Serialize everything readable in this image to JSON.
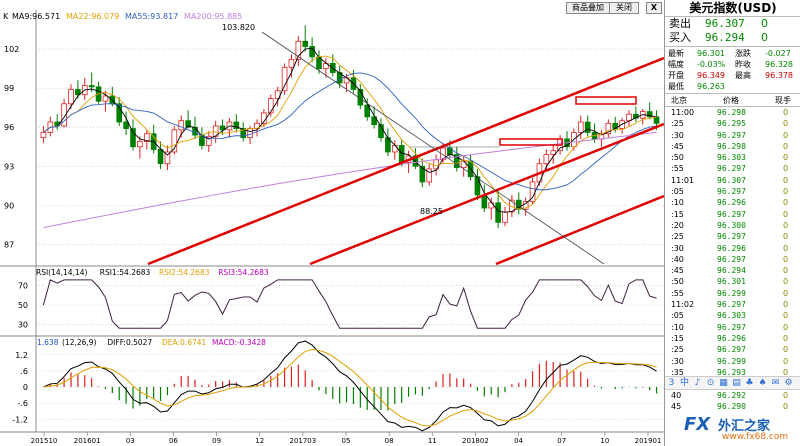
{
  "toolbar": {
    "k_label": "K",
    "ma_labels": [
      {
        "text": "MA9:96.571",
        "color": "#000000"
      },
      {
        "text": "MA22:96.079",
        "color": "#e0a000"
      },
      {
        "text": "MA55:93.817",
        "color": "#3060c0"
      },
      {
        "text": "MA200:95.885",
        "color": "#c080e0"
      }
    ],
    "add_button": "商品叠加",
    "close_button": "关闭",
    "x_button": "X"
  },
  "price_axis": [
    "102",
    "99",
    "96",
    "93",
    "90",
    "87"
  ],
  "annotations": {
    "high": "103.820",
    "low": "88.25"
  },
  "rsi": {
    "header": [
      {
        "text": "RSI(14,14,14)",
        "color": "#000000"
      },
      {
        "text": "RSI1:54.2683",
        "color": "#000000"
      },
      {
        "text": "RSI2:54.2683",
        "color": "#e0a000"
      },
      {
        "text": "RSI3:54.2683",
        "color": "#c000c0"
      }
    ],
    "axis": [
      "70",
      "50",
      "30"
    ]
  },
  "macd": {
    "left_value": "1.638",
    "header": [
      {
        "text": "(12,26,9)",
        "color": "#000000"
      },
      {
        "text": "DIFF:0.5027",
        "color": "#000000"
      },
      {
        "text": "DEA:0.6741",
        "color": "#e0a000"
      },
      {
        "text": "MACD:-0.3428",
        "color": "#c000c0"
      }
    ],
    "axis": [
      "1.2",
      ".6",
      "0",
      "-.6",
      "-1.2"
    ]
  },
  "date_axis": [
    "201510",
    "201601",
    "03",
    "06",
    "09",
    "12",
    "201703",
    "05",
    "08",
    "11",
    "201802",
    "04",
    "07",
    "10",
    "201901"
  ],
  "chart_data": {
    "type": "candlestick",
    "ylim": [
      85.5,
      105.0
    ],
    "ohlc": [
      [
        95.2,
        96.1,
        94.8,
        95.6
      ],
      [
        95.6,
        96.8,
        95.3,
        96.4
      ],
      [
        96.4,
        97.0,
        95.8,
        96.1
      ],
      [
        96.1,
        98.2,
        96.0,
        97.8
      ],
      [
        97.8,
        99.3,
        97.4,
        98.9
      ],
      [
        98.9,
        99.6,
        98.2,
        98.5
      ],
      [
        98.5,
        99.8,
        98.1,
        99.2
      ],
      [
        99.2,
        100.2,
        98.7,
        99.1
      ],
      [
        99.1,
        99.5,
        97.8,
        98.0
      ],
      [
        98.0,
        98.8,
        97.2,
        98.4
      ],
      [
        98.4,
        99.1,
        97.6,
        97.8
      ],
      [
        97.8,
        98.3,
        96.1,
        96.4
      ],
      [
        96.4,
        97.2,
        95.4,
        95.9
      ],
      [
        95.9,
        96.6,
        94.2,
        94.5
      ],
      [
        94.5,
        95.3,
        93.6,
        94.9
      ],
      [
        94.9,
        95.8,
        94.3,
        95.5
      ],
      [
        95.5,
        96.2,
        94.0,
        94.3
      ],
      [
        94.3,
        94.9,
        92.8,
        93.2
      ],
      [
        93.2,
        94.6,
        92.7,
        94.1
      ],
      [
        94.1,
        96.1,
        93.9,
        95.8
      ],
      [
        95.8,
        96.9,
        95.2,
        96.5
      ],
      [
        96.5,
        97.3,
        95.9,
        96.0
      ],
      [
        96.0,
        96.8,
        95.1,
        95.4
      ],
      [
        95.4,
        96.0,
        94.3,
        94.6
      ],
      [
        94.6,
        95.7,
        94.1,
        95.3
      ],
      [
        95.3,
        96.5,
        94.8,
        96.1
      ],
      [
        96.1,
        96.6,
        95.4,
        95.8
      ],
      [
        95.8,
        96.7,
        95.2,
        96.4
      ],
      [
        96.4,
        97.0,
        95.6,
        95.9
      ],
      [
        95.9,
        96.4,
        94.9,
        95.2
      ],
      [
        95.2,
        96.1,
        94.7,
        95.9
      ],
      [
        95.9,
        96.6,
        95.3,
        96.3
      ],
      [
        96.3,
        97.4,
        96.0,
        97.1
      ],
      [
        97.1,
        98.5,
        96.8,
        98.2
      ],
      [
        98.2,
        99.1,
        97.6,
        98.8
      ],
      [
        98.8,
        100.9,
        98.5,
        100.6
      ],
      [
        100.6,
        101.6,
        99.8,
        101.2
      ],
      [
        101.2,
        103.0,
        100.7,
        102.6
      ],
      [
        102.6,
        103.82,
        101.8,
        102.2
      ],
      [
        102.2,
        102.9,
        101.0,
        101.4
      ],
      [
        101.4,
        101.9,
        100.1,
        100.5
      ],
      [
        100.5,
        101.3,
        99.8,
        100.9
      ],
      [
        100.9,
        101.6,
        99.9,
        100.2
      ],
      [
        100.2,
        100.7,
        99.0,
        99.4
      ],
      [
        99.4,
        100.1,
        98.7,
        99.8
      ],
      [
        99.8,
        100.4,
        98.6,
        98.9
      ],
      [
        98.9,
        99.3,
        97.4,
        97.7
      ],
      [
        97.7,
        98.2,
        96.5,
        96.8
      ],
      [
        96.8,
        97.6,
        95.9,
        96.2
      ],
      [
        96.2,
        96.7,
        94.9,
        95.2
      ],
      [
        95.2,
        95.9,
        93.8,
        94.1
      ],
      [
        94.1,
        95.0,
        93.5,
        94.6
      ],
      [
        94.6,
        95.1,
        93.0,
        93.3
      ],
      [
        93.3,
        94.2,
        92.5,
        93.8
      ],
      [
        93.8,
        94.4,
        92.8,
        93.0
      ],
      [
        93.0,
        93.6,
        91.4,
        91.8
      ],
      [
        91.8,
        93.2,
        91.5,
        92.8
      ],
      [
        92.8,
        93.9,
        92.3,
        93.5
      ],
      [
        93.5,
        94.8,
        93.2,
        94.4
      ],
      [
        94.4,
        95.0,
        93.6,
        93.9
      ],
      [
        93.9,
        94.5,
        92.6,
        92.9
      ],
      [
        92.9,
        93.8,
        92.2,
        93.4
      ],
      [
        93.4,
        93.9,
        91.9,
        92.2
      ],
      [
        92.2,
        92.8,
        90.4,
        90.8
      ],
      [
        90.8,
        91.6,
        89.5,
        89.8
      ],
      [
        89.8,
        90.6,
        88.9,
        90.2
      ],
      [
        90.2,
        91.1,
        88.25,
        88.7
      ],
      [
        88.7,
        89.9,
        88.4,
        89.5
      ],
      [
        89.5,
        90.8,
        89.1,
        90.4
      ],
      [
        90.4,
        91.0,
        89.3,
        89.7
      ],
      [
        89.7,
        90.6,
        89.2,
        90.3
      ],
      [
        90.3,
        92.1,
        90.1,
        91.8
      ],
      [
        91.8,
        93.6,
        91.5,
        93.2
      ],
      [
        93.2,
        94.3,
        92.6,
        93.9
      ],
      [
        93.9,
        94.6,
        93.2,
        94.2
      ],
      [
        94.2,
        95.4,
        93.9,
        95.1
      ],
      [
        95.1,
        95.7,
        94.2,
        94.5
      ],
      [
        94.5,
        95.9,
        94.2,
        95.6
      ],
      [
        95.6,
        96.9,
        95.1,
        96.4
      ],
      [
        96.4,
        96.9,
        95.3,
        95.6
      ],
      [
        95.6,
        96.3,
        94.8,
        95.1
      ],
      [
        95.1,
        95.8,
        94.5,
        95.5
      ],
      [
        95.5,
        96.6,
        95.2,
        96.3
      ],
      [
        96.3,
        96.8,
        95.6,
        95.9
      ],
      [
        95.9,
        96.7,
        95.5,
        96.5
      ],
      [
        96.5,
        97.3,
        96.1,
        97.0
      ],
      [
        97.0,
        97.6,
        96.4,
        96.7
      ],
      [
        96.7,
        97.4,
        96.2,
        97.2
      ],
      [
        97.2,
        97.9,
        96.6,
        96.8
      ],
      [
        96.8,
        97.3,
        95.8,
        96.3
      ]
    ],
    "price_levels": {
      "open": 96.349,
      "high": 96.378,
      "low": 96.263,
      "last": 96.301
    }
  },
  "quote": {
    "title": "美元指数(USD)",
    "sell_label": "卖出",
    "sell_value": "96.307",
    "sell_vol": "0",
    "buy_label": "买入",
    "buy_value": "96.294",
    "buy_vol": "0",
    "stats": [
      [
        {
          "l": "最新",
          "v": "96.301"
        },
        {
          "l": "涨跌",
          "v": "-0.027"
        }
      ],
      [
        {
          "l": "幅度",
          "v": "-0.03%"
        },
        {
          "l": "昨收",
          "v": "96.328"
        }
      ],
      [
        {
          "l": "开盘",
          "v": "96.349"
        },
        {
          "l": "最高",
          "v": "96.378"
        }
      ],
      [
        {
          "l": "最低",
          "v": "96.263"
        },
        {
          "l": "",
          "v": ""
        }
      ]
    ],
    "tick_header": {
      "time": "北京",
      "price": "价格",
      "vol": "现手"
    },
    "ticks": [
      {
        "t": "11:00",
        "p": "96.298",
        "v": "0"
      },
      {
        "t": ":25",
        "p": "96.295",
        "v": "0"
      },
      {
        "t": ":30",
        "p": "96.297",
        "v": "0"
      },
      {
        "t": ":45",
        "p": "96.298",
        "v": "0"
      },
      {
        "t": ":50",
        "p": "96.303",
        "v": "0"
      },
      {
        "t": ":55",
        "p": "96.297",
        "v": "0"
      },
      {
        "t": "11:01",
        "p": "96.307",
        "v": "0"
      },
      {
        "t": ":05",
        "p": "96.297",
        "v": "0"
      },
      {
        "t": ":10",
        "p": "96.296",
        "v": "0"
      },
      {
        "t": ":15",
        "p": "96.297",
        "v": "0"
      },
      {
        "t": ":20",
        "p": "96.300",
        "v": "0"
      },
      {
        "t": ":25",
        "p": "96.297",
        "v": "0"
      },
      {
        "t": ":30",
        "p": "96.296",
        "v": "0"
      },
      {
        "t": ":40",
        "p": "96.297",
        "v": "0"
      },
      {
        "t": ":45",
        "p": "96.294",
        "v": "0"
      },
      {
        "t": ":50",
        "p": "96.301",
        "v": "0"
      },
      {
        "t": ":55",
        "p": "96.299",
        "v": "0"
      },
      {
        "t": "11:02",
        "p": "96.297",
        "v": "0"
      },
      {
        "t": ":05",
        "p": "96.303",
        "v": "0"
      },
      {
        "t": ":10",
        "p": "96.297",
        "v": "0"
      },
      {
        "t": ":15",
        "p": "96.296",
        "v": "0"
      },
      {
        "t": ":25",
        "p": "96.297",
        "v": "0"
      },
      {
        "t": ":30",
        "p": "96.299",
        "v": "0"
      },
      {
        "t": ":35",
        "p": "96.293",
        "v": "0"
      }
    ],
    "ticks_after": [
      {
        "t": "40",
        "p": "96.292",
        "v": "0"
      },
      {
        "t": "45",
        "p": "96.290",
        "v": "0"
      }
    ],
    "icon_bar": [
      "3",
      "中",
      "♪",
      "⊙",
      "▦",
      "▤",
      "♣",
      "♠",
      "✉",
      "⚙"
    ]
  },
  "watermark": {
    "fx": "FX",
    "cn": "外汇之家",
    "site": "www.fx68.com"
  }
}
